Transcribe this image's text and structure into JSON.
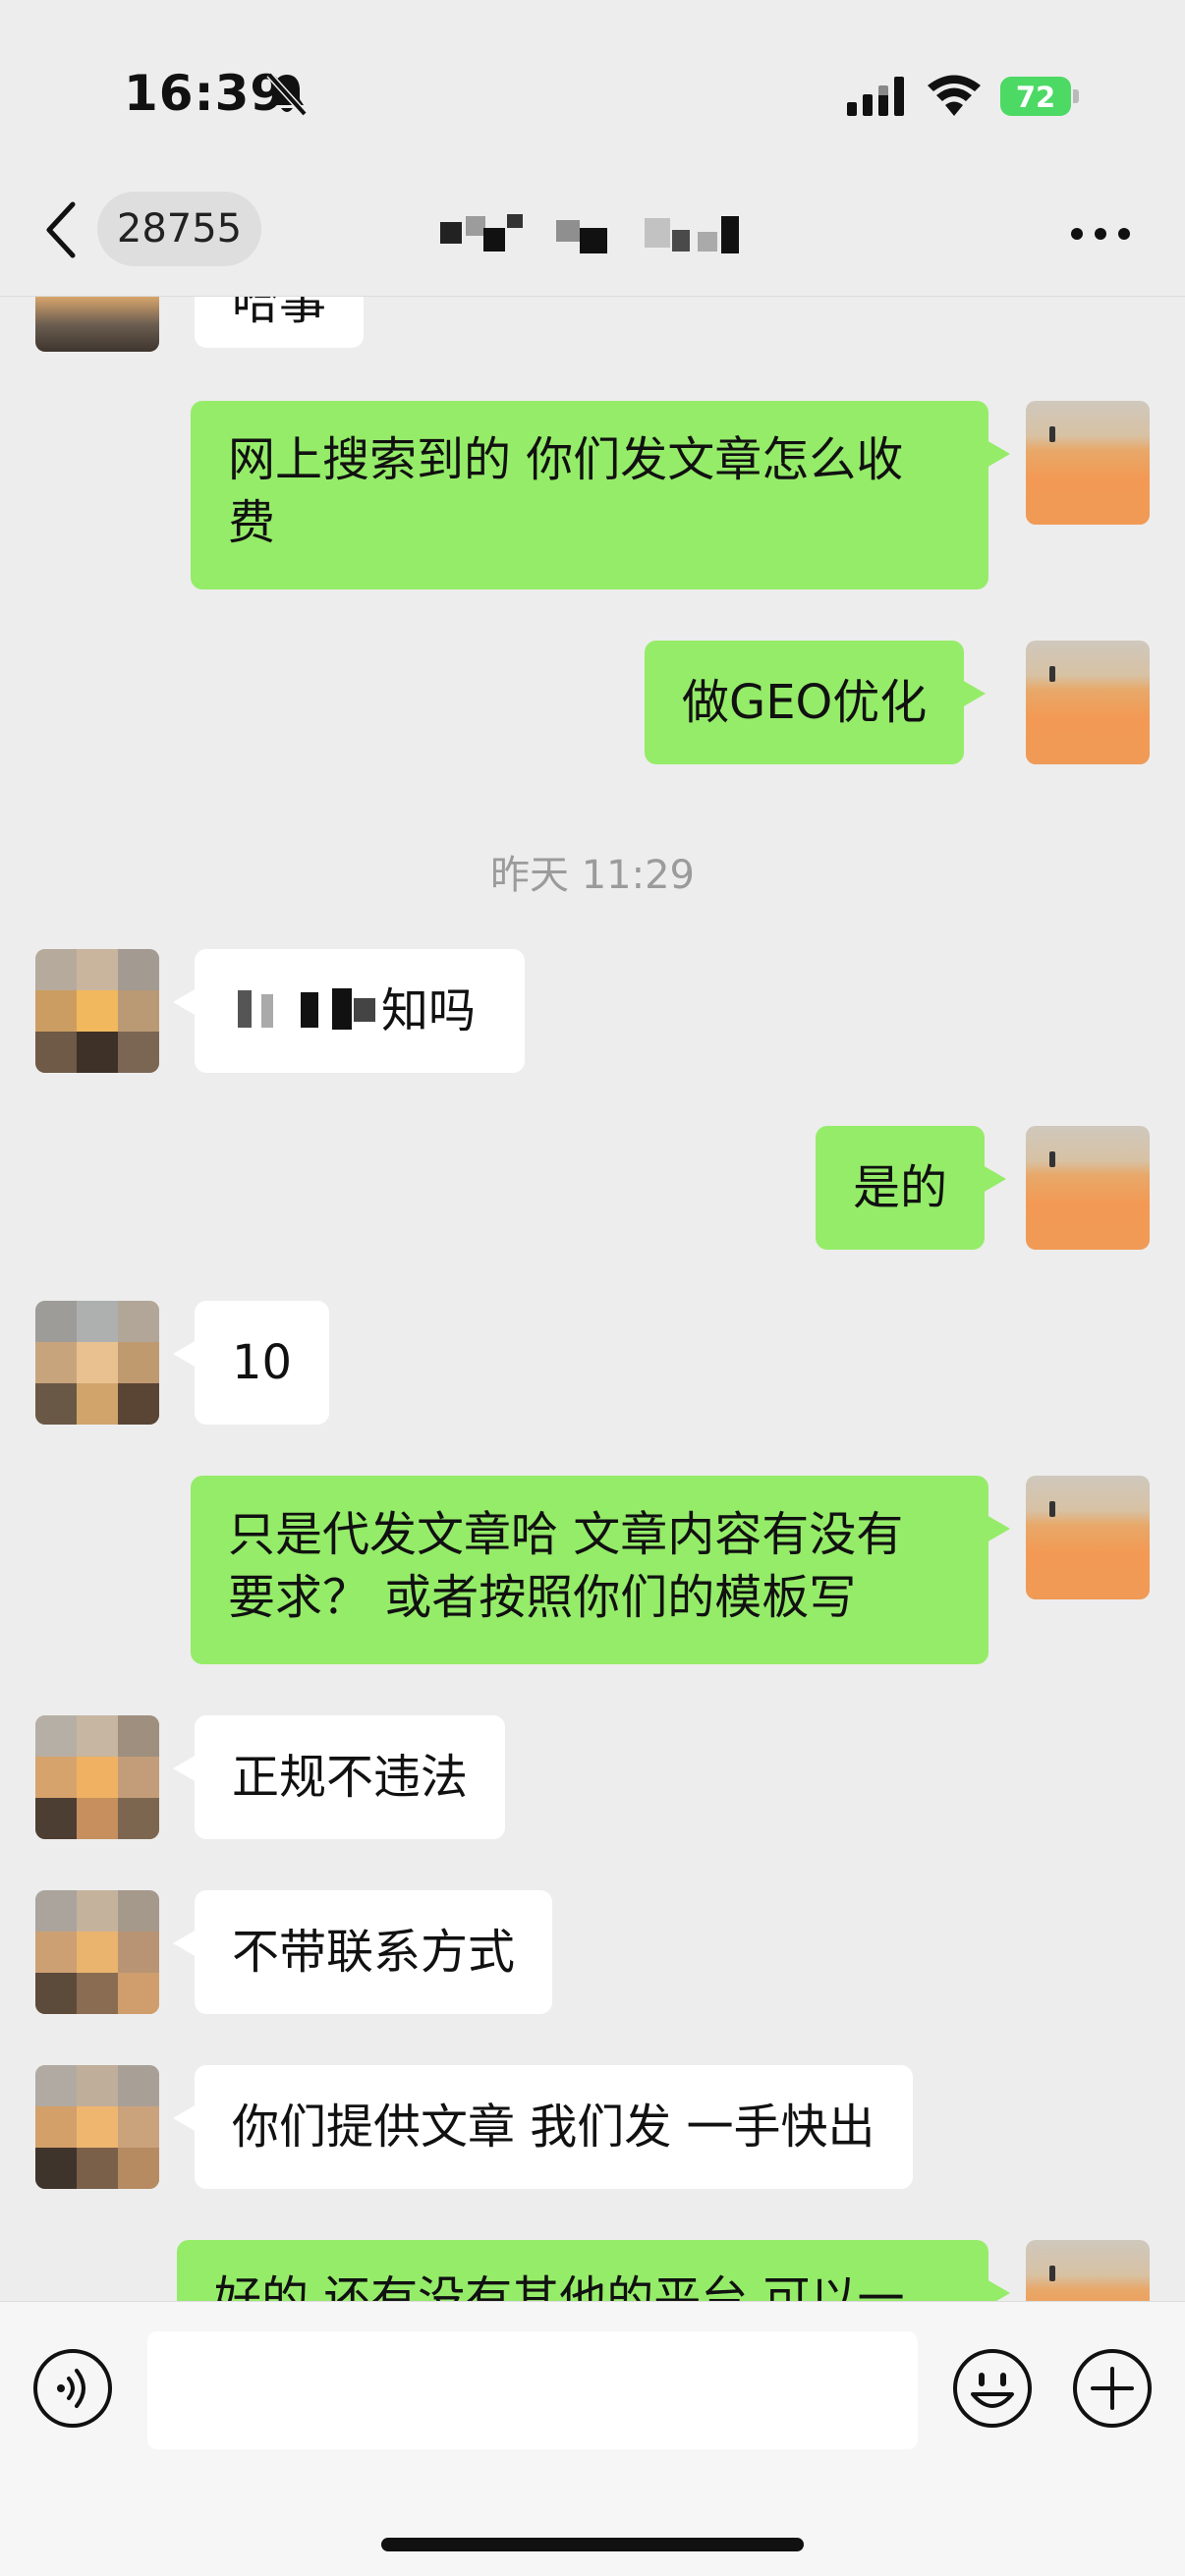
{
  "status_bar": {
    "time": "16:39",
    "battery_percent": "72",
    "battery_color": "#4cd964",
    "icons": [
      "bell-slash-icon",
      "cellular-signal-icon",
      "wifi-icon",
      "battery-icon"
    ]
  },
  "nav": {
    "back_icon": "chevron-left-icon",
    "unread_count": "28755",
    "title_redacted": true,
    "more_icon": "ellipsis-icon"
  },
  "colors": {
    "background": "#ededed",
    "my_bubble": "#95ec69",
    "their_bubble": "#ffffff",
    "timestamp_text": "#9b9b9b"
  },
  "messages": [
    {
      "sender": "them",
      "text": "哈事",
      "partial": true
    },
    {
      "sender": "me",
      "lines": [
        "网上搜索到的 你们发文章怎么收",
        "费"
      ]
    },
    {
      "sender": "me",
      "text": "做GEO优化"
    },
    {
      "type": "timestamp",
      "text": "昨天 11:29"
    },
    {
      "sender": "them",
      "text": "知吗",
      "redacted_prefix": true
    },
    {
      "sender": "me",
      "text": "是的"
    },
    {
      "sender": "them",
      "text": "10"
    },
    {
      "sender": "me",
      "lines": [
        "只是代发文章哈 文章内容有没有",
        "要求？ 或者按照你们的模板写"
      ]
    },
    {
      "sender": "them",
      "text": "正规不违法"
    },
    {
      "sender": "them",
      "text": "不带联系方式"
    },
    {
      "sender": "them",
      "text": "你们提供文章 我们发 一手快出"
    },
    {
      "sender": "me",
      "text": "好的 还有没有其他的平台 可以一",
      "partial": true
    }
  ],
  "input_bar": {
    "voice_icon": "voice-icon",
    "emoji_icon": "emoji-icon",
    "plus_icon": "plus-icon",
    "input_value": ""
  }
}
